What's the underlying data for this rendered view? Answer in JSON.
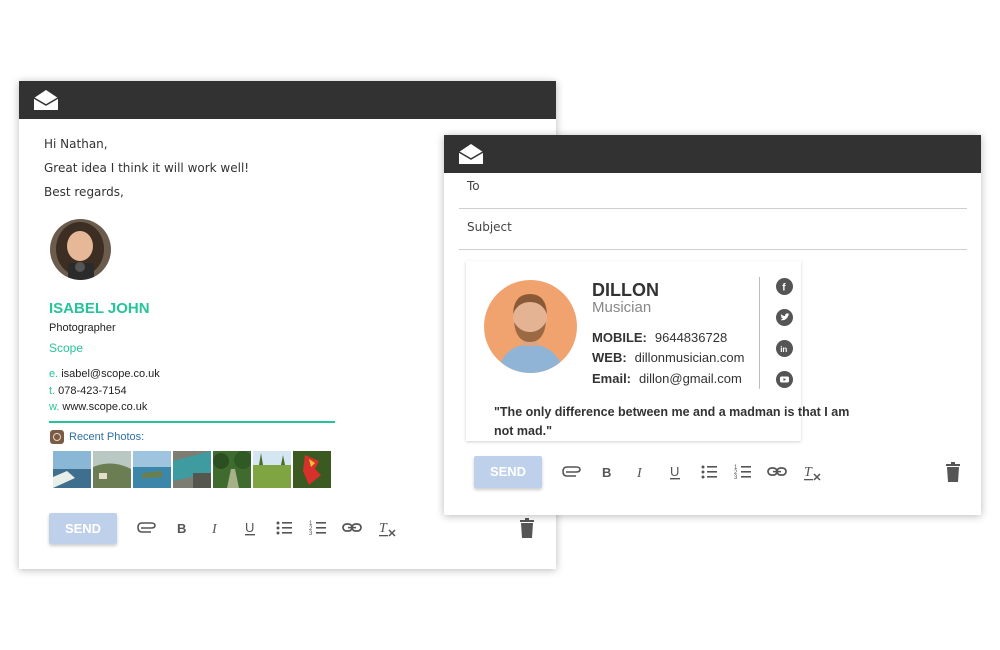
{
  "left_card": {
    "message_lines": [
      "Hi Nathan,",
      "Great idea I think it will work well!",
      "Best regards,"
    ],
    "signature": {
      "name": "ISABEL JOHN",
      "role": "Photographer",
      "company": "Scope",
      "email_prefix": "e.",
      "email": "isabel@scope.co.uk",
      "phone_prefix": "t.",
      "phone": "078-423-7154",
      "web_prefix": "w.",
      "web": "www.scope.co.uk",
      "recent_photos_label": "Recent Photos:",
      "photo_count": 7
    },
    "send_label": "SEND"
  },
  "right_card": {
    "to_label": "To",
    "subject_label": "Subject",
    "signature": {
      "name": "DILLON",
      "role": "Musician",
      "mobile_label": "MOBILE:",
      "mobile": "9644836728",
      "web_label": "WEB:",
      "web": "dillonmusician.com",
      "email_label": "Email:",
      "email": "dillon@gmail.com",
      "social_icons": [
        "facebook-icon",
        "twitter-icon",
        "linkedin-icon",
        "youtube-icon"
      ],
      "quote": "\"The only difference between me and a madman is that I am not mad.\""
    },
    "send_label": "SEND"
  },
  "toolbar_icons": [
    "attach-icon",
    "bold-icon",
    "italic-icon",
    "underline-icon",
    "bulleted-list-icon",
    "numbered-list-icon",
    "link-icon",
    "clear-format-icon"
  ],
  "colors": {
    "header": "#323232",
    "accent_green": "#26c49a",
    "send_button": "#bfd0ea",
    "recent_photos_link": "#2d6fa5"
  }
}
